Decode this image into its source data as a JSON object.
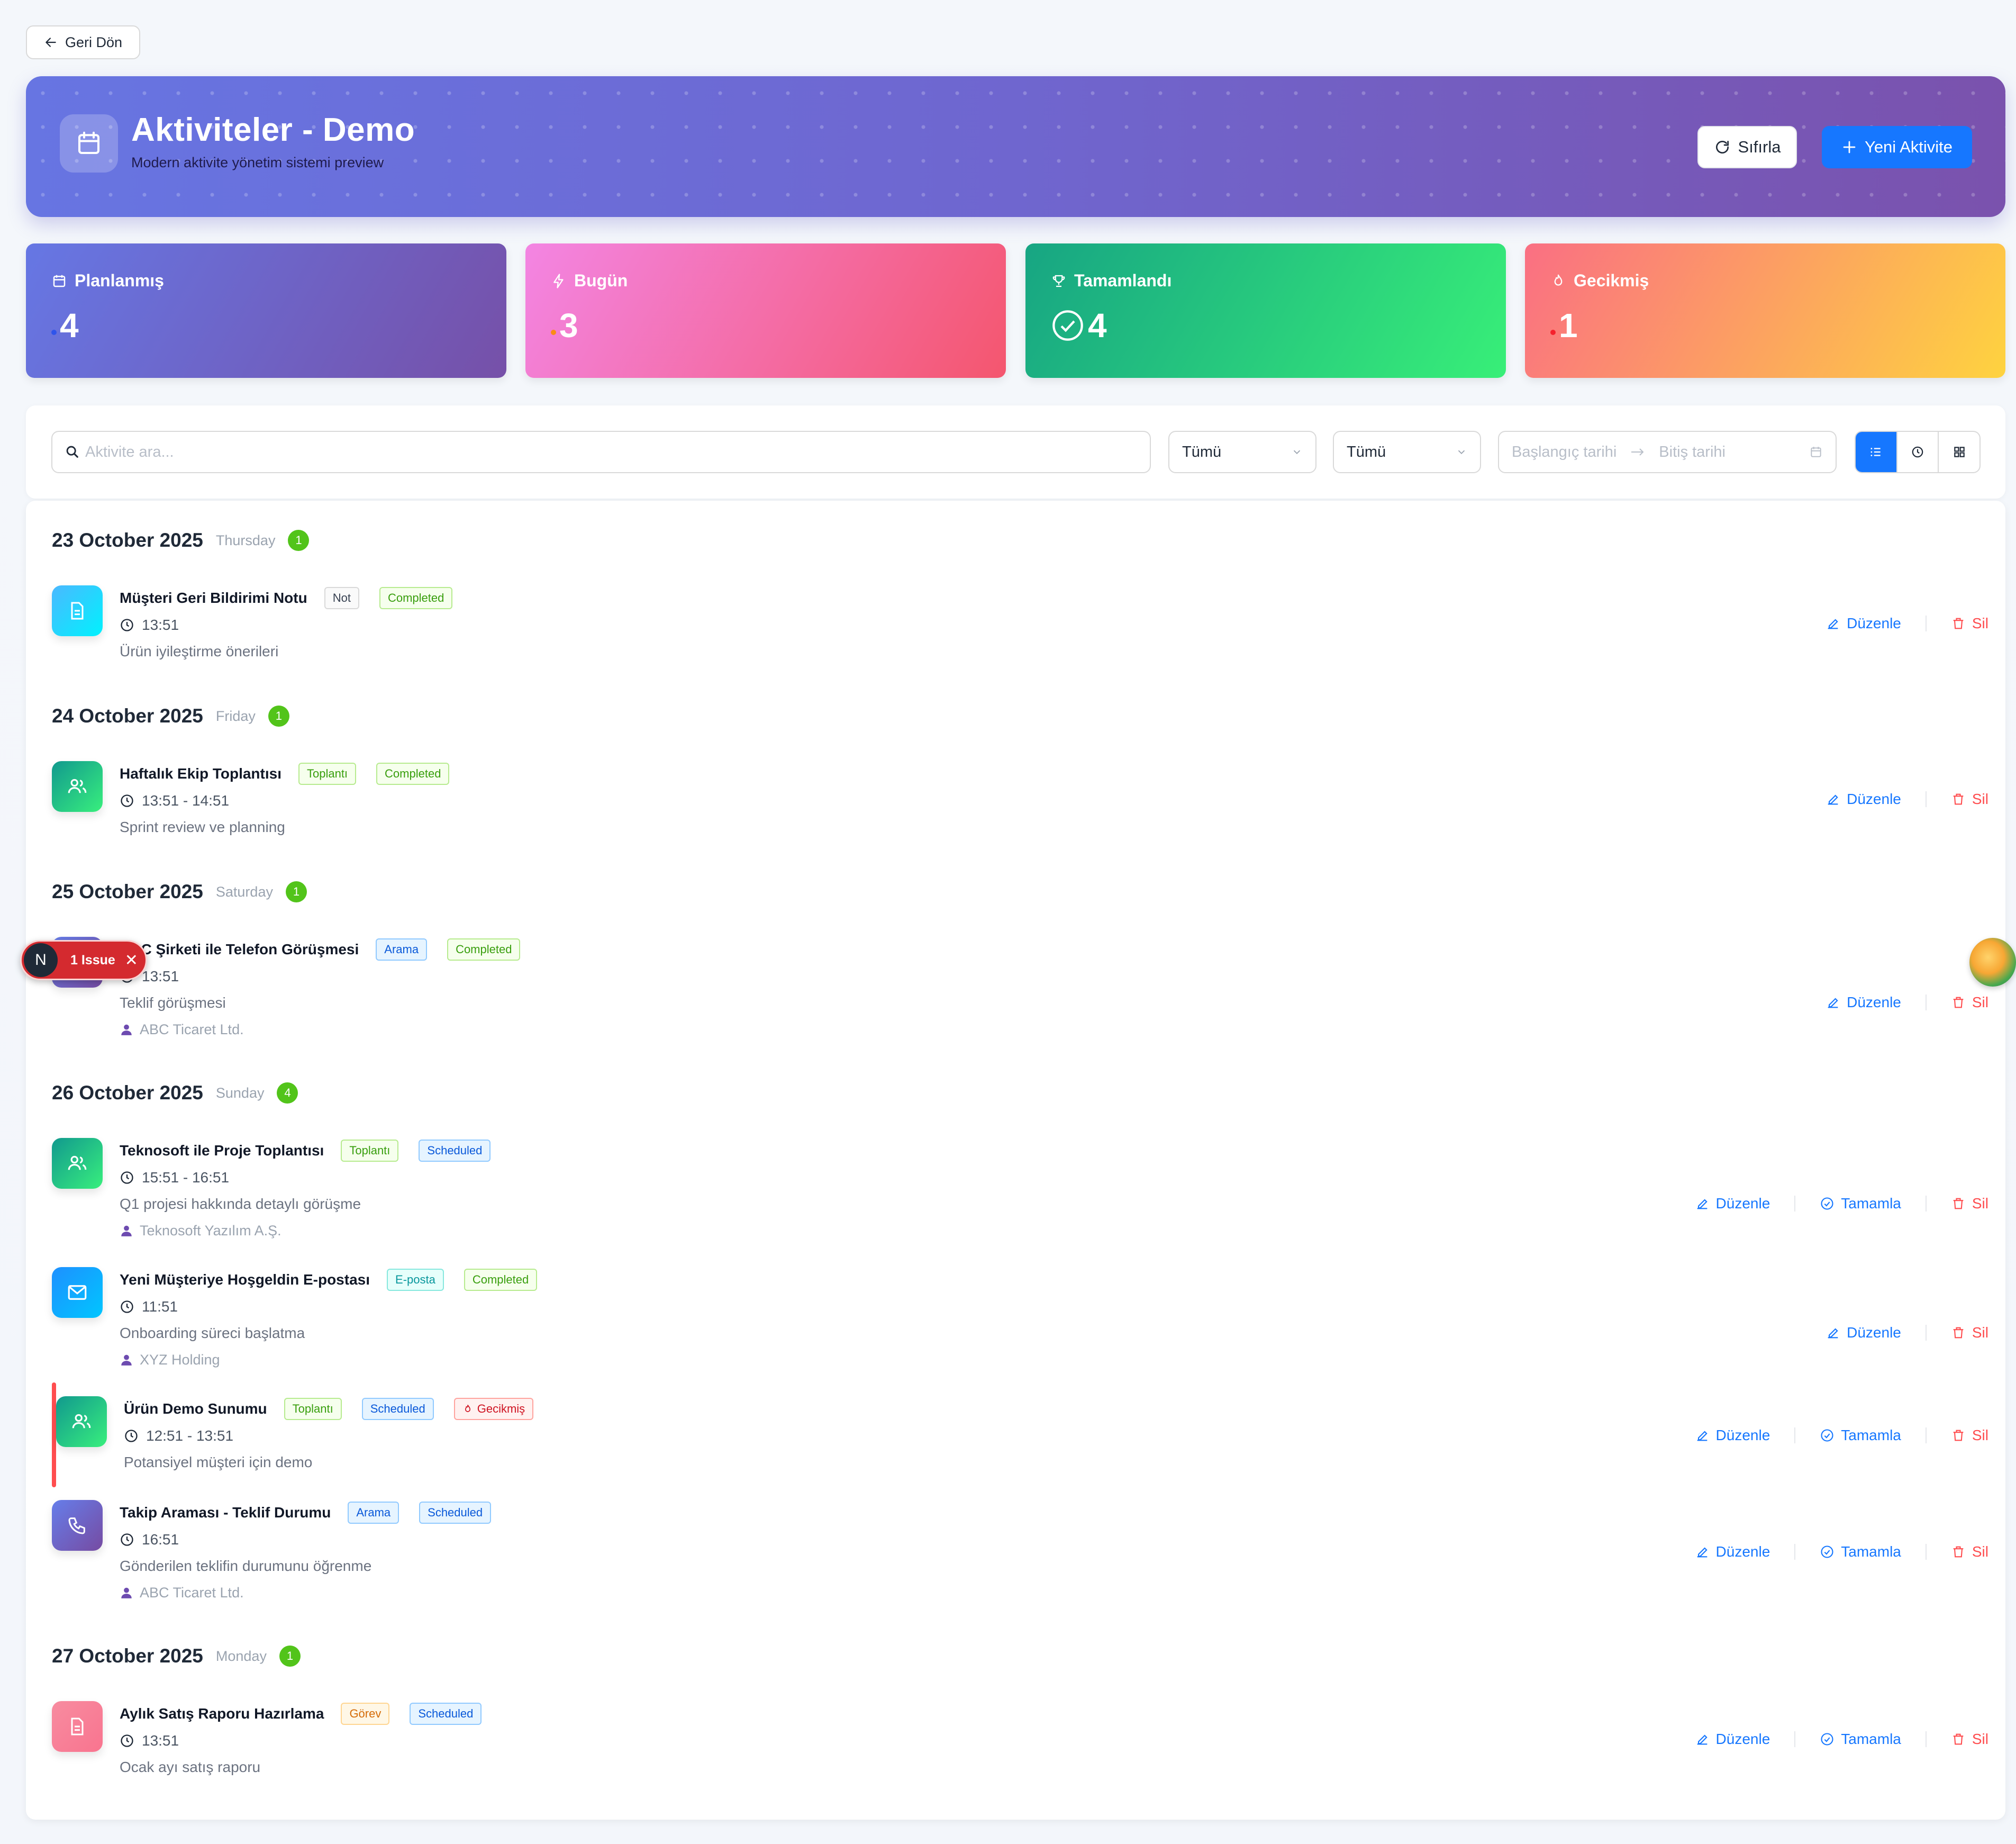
{
  "nav": {
    "back_label": "Geri Dön"
  },
  "header": {
    "title": "Aktiviteler - Demo",
    "subtitle": "Modern aktivite yönetim sistemi preview",
    "reset_label": "Sıfırla",
    "new_label": "Yeni Aktivite"
  },
  "stats": [
    {
      "label": "Planlanmış",
      "value": "4",
      "icon": "calendar-icon",
      "dot_color": "#2f54eb"
    },
    {
      "label": "Bugün",
      "value": "3",
      "icon": "lightning-icon",
      "dot_color": "#fa8c16"
    },
    {
      "label": "Tamamlandı",
      "value": "4",
      "icon": "trophy-icon",
      "dot_color": ""
    },
    {
      "label": "Gecikmiş",
      "value": "1",
      "icon": "fire-icon",
      "dot_color": "#f5222d"
    }
  ],
  "filters": {
    "search_placeholder": "Aktivite ara...",
    "type_select": "Tümü",
    "status_select": "Tümü",
    "start_placeholder": "Başlangıç tarihi",
    "end_placeholder": "Bitiş tarihi",
    "view_modes": [
      "list-icon",
      "clock-icon",
      "grid-icon"
    ]
  },
  "actions": {
    "edit": "Düzenle",
    "complete": "Tamamla",
    "delete": "Sil"
  },
  "groups": [
    {
      "date": "23 October 2025",
      "day": "Thursday",
      "count": "1",
      "items": [
        {
          "title": "Müşteri Geri Bildirimi Notu",
          "type": "Not",
          "status": "Completed",
          "time": "13:51",
          "desc": "Ürün iyileştirme önerileri",
          "icon": "note-icon"
        }
      ]
    },
    {
      "date": "24 October 2025",
      "day": "Friday",
      "count": "1",
      "items": [
        {
          "title": "Haftalık Ekip Toplantısı",
          "type": "Toplantı",
          "status": "Completed",
          "time": "13:51 - 14:51",
          "desc": "Sprint review ve planning",
          "icon": "meeting-icon"
        }
      ]
    },
    {
      "date": "25 October 2025",
      "day": "Saturday",
      "count": "1",
      "items": [
        {
          "title": "ABC Şirketi ile Telefon Görüşmesi",
          "type": "Arama",
          "status": "Completed",
          "time": "13:51",
          "desc": "Teklif görüşmesi",
          "company": "ABC Ticaret Ltd.",
          "icon": "phone-icon"
        }
      ]
    },
    {
      "date": "26 October 2025",
      "day": "Sunday",
      "count": "4",
      "items": [
        {
          "title": "Teknosoft ile Proje Toplantısı",
          "type": "Toplantı",
          "status": "Scheduled",
          "time": "15:51 - 16:51",
          "desc": "Q1 projesi hakkında detaylı görüşme",
          "company": "Teknosoft Yazılım A.Ş.",
          "icon": "meeting-icon"
        },
        {
          "title": "Yeni Müşteriye Hoşgeldin E-postası",
          "type": "E-posta",
          "status": "Completed",
          "time": "11:51",
          "desc": "Onboarding süreci başlatma",
          "company": "XYZ Holding",
          "icon": "mail-icon"
        },
        {
          "title": "Ürün Demo Sunumu",
          "type": "Toplantı",
          "status": "Scheduled",
          "overdue": "Gecikmiş",
          "time": "12:51 - 13:51",
          "desc": "Potansiyel müşteri için demo",
          "icon": "meeting-icon"
        },
        {
          "title": "Takip Araması - Teklif Durumu",
          "type": "Arama",
          "status": "Scheduled",
          "time": "16:51",
          "desc": "Gönderilen teklifin durumunu öğrenme",
          "company": "ABC Ticaret Ltd.",
          "icon": "phone-icon"
        }
      ]
    },
    {
      "date": "27 October 2025",
      "day": "Monday",
      "count": "1",
      "items": [
        {
          "title": "Aylık Satış Raporu Hazırlama",
          "type": "Görev",
          "status": "Scheduled",
          "time": "13:51",
          "desc": "Ocak ayı satış raporu",
          "icon": "task-icon"
        }
      ]
    }
  ],
  "issue_badge": {
    "letter": "N",
    "text": "1 Issue"
  }
}
